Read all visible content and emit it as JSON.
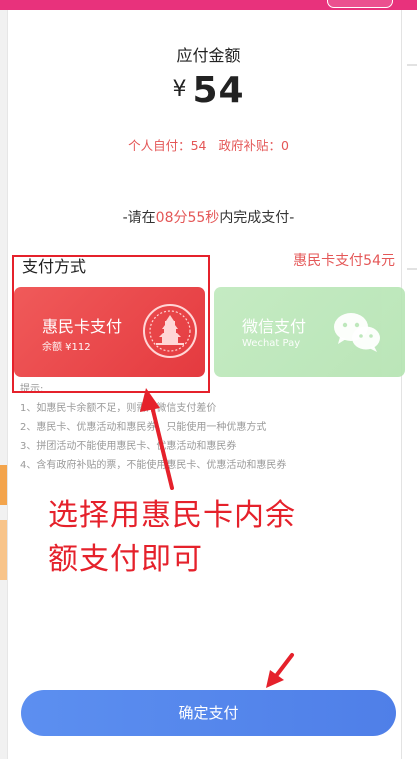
{
  "payment": {
    "amount_label": "应付金额",
    "currency_symbol": "¥",
    "amount": "54",
    "self_pay_label": "个人自付：54",
    "subsidy_label": "政府补贴：0",
    "countdown_prefix": "-请在",
    "countdown_time": "08分55秒",
    "countdown_suffix": "内完成支付-"
  },
  "methods": {
    "title": "支付方式",
    "summary": "惠民卡支付54元",
    "huimin_card": {
      "name": "惠民卡支付",
      "balance": "余额 ¥112"
    },
    "wechat": {
      "name": "微信支付",
      "subtitle": "Wechat Pay"
    }
  },
  "tips": {
    "heading": "提示:",
    "items": [
      "1、如惠民卡余额不足，则需用微信支付差价",
      "2、惠民卡、优惠活动和惠民券，只能使用一种优惠方式",
      "3、拼团活动不能使用惠民卡、优惠活动和惠民券",
      "4、含有政府补贴的票，不能使用惠民卡、优惠活动和惠民券"
    ]
  },
  "annotation": {
    "line1": "选择用惠民卡内余",
    "line2": "额支付即可"
  },
  "actions": {
    "confirm_label": "确定支付"
  },
  "colors": {
    "accent_red": "#e45757",
    "card_red": "#e94749",
    "wechat_green": "#b8e6b5",
    "button_blue": "#5585ec",
    "annotation_red": "#e5212b"
  }
}
